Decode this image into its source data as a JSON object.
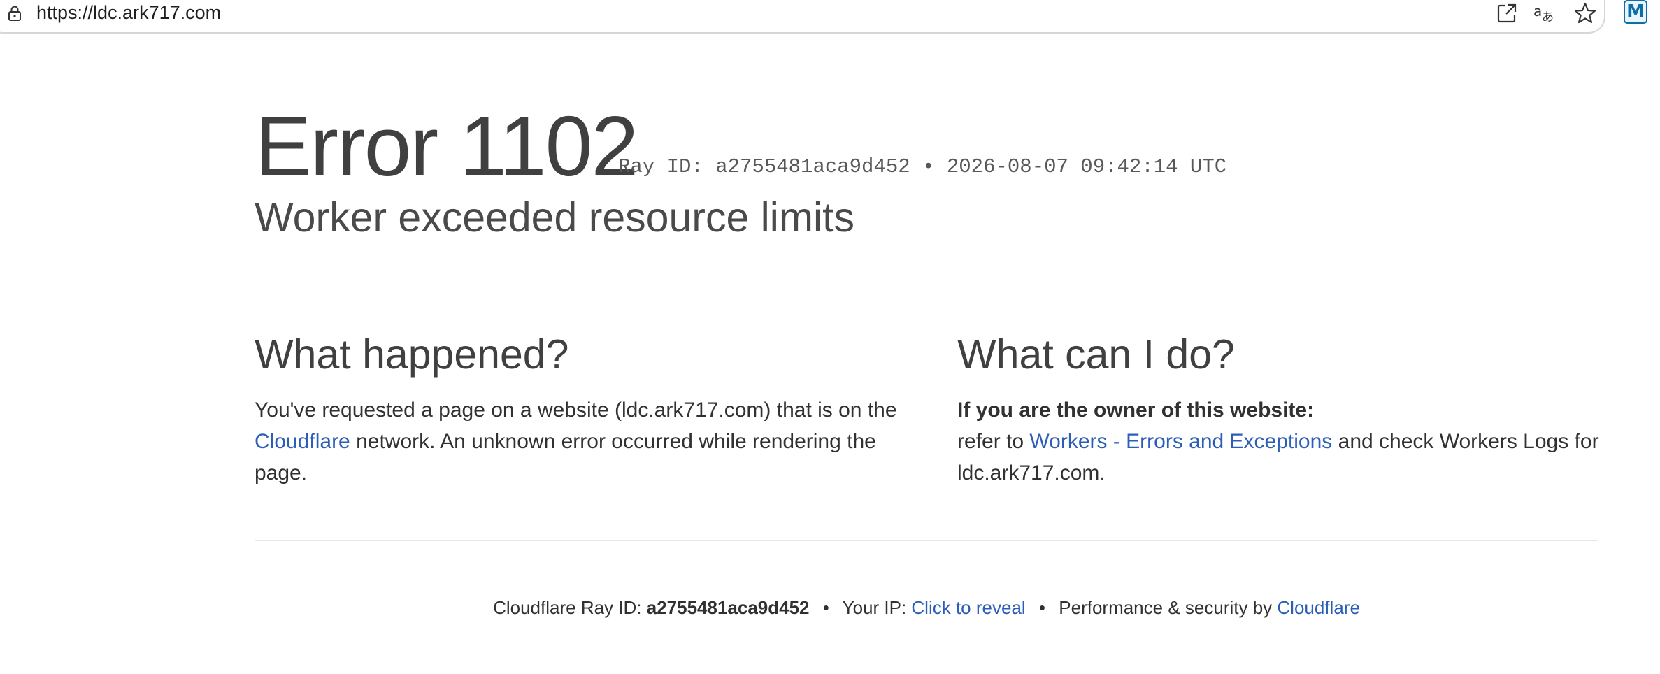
{
  "browser": {
    "url": "https://ldc.ark717.com",
    "icons": [
      "lock-icon",
      "open-in-app-icon",
      "translate-icon",
      "favorite-star-icon",
      "profile-extension-icon"
    ],
    "profile_letter": "M"
  },
  "error": {
    "title": "Error 1102",
    "ray_text": "Ray ID: a2755481aca9d452 • 2026-08-07 09:42:14 UTC",
    "subtitle": "Worker exceeded resource limits"
  },
  "what_happened": {
    "heading": "What happened?",
    "text_before": "You've requested a page on a website (ldc.ark717.com) that is on the ",
    "link": "Cloudflare",
    "text_after": " network. An unknown error occurred while rendering the page."
  },
  "what_can_i_do": {
    "heading": "What can I do?",
    "owner_label": "If you are the owner of this website:",
    "text_before": "refer to ",
    "link": "Workers - Errors and Exceptions",
    "text_after": " and check Workers Logs for ldc.ark717.com."
  },
  "footer": {
    "ray_label": "Cloudflare Ray ID: ",
    "ray_id": "a2755481aca9d452",
    "bullet": "•",
    "ip_label": "Your IP: ",
    "ip_link": "Click to reveal",
    "perf_label": "Performance & security by ",
    "perf_link": "Cloudflare"
  },
  "colors": {
    "link": "#2c5eb8",
    "text": "#313131",
    "heading": "#404040"
  }
}
